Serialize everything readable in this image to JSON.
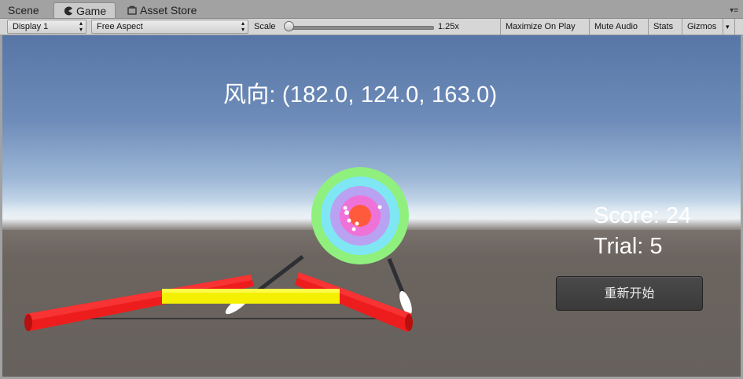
{
  "tabs": [
    {
      "label": "Scene",
      "active": false,
      "icon": "none"
    },
    {
      "label": "Game",
      "active": true,
      "icon": "pacman-icon"
    },
    {
      "label": "Asset Store",
      "active": false,
      "icon": "store-icon"
    }
  ],
  "toolbar": {
    "display": "Display 1",
    "aspect": "Free Aspect",
    "scale_label": "Scale",
    "scale_value": "1.25x",
    "maximize": "Maximize On Play",
    "mute": "Mute Audio",
    "stats": "Stats",
    "gizmos": "Gizmos"
  },
  "game": {
    "wind_text": "风向: (182.0, 124.0, 163.0)",
    "score_text": "Score: 24",
    "trial_text": "Trial: 5",
    "restart_label": "重新开始"
  },
  "colors": {
    "bow_red": "#f01818",
    "bow_grip": "#f4f000",
    "target_rings": [
      "#8ff07e",
      "#7fe7f4",
      "#b9a2f2",
      "#ef72d8",
      "#ff5a3c"
    ]
  }
}
